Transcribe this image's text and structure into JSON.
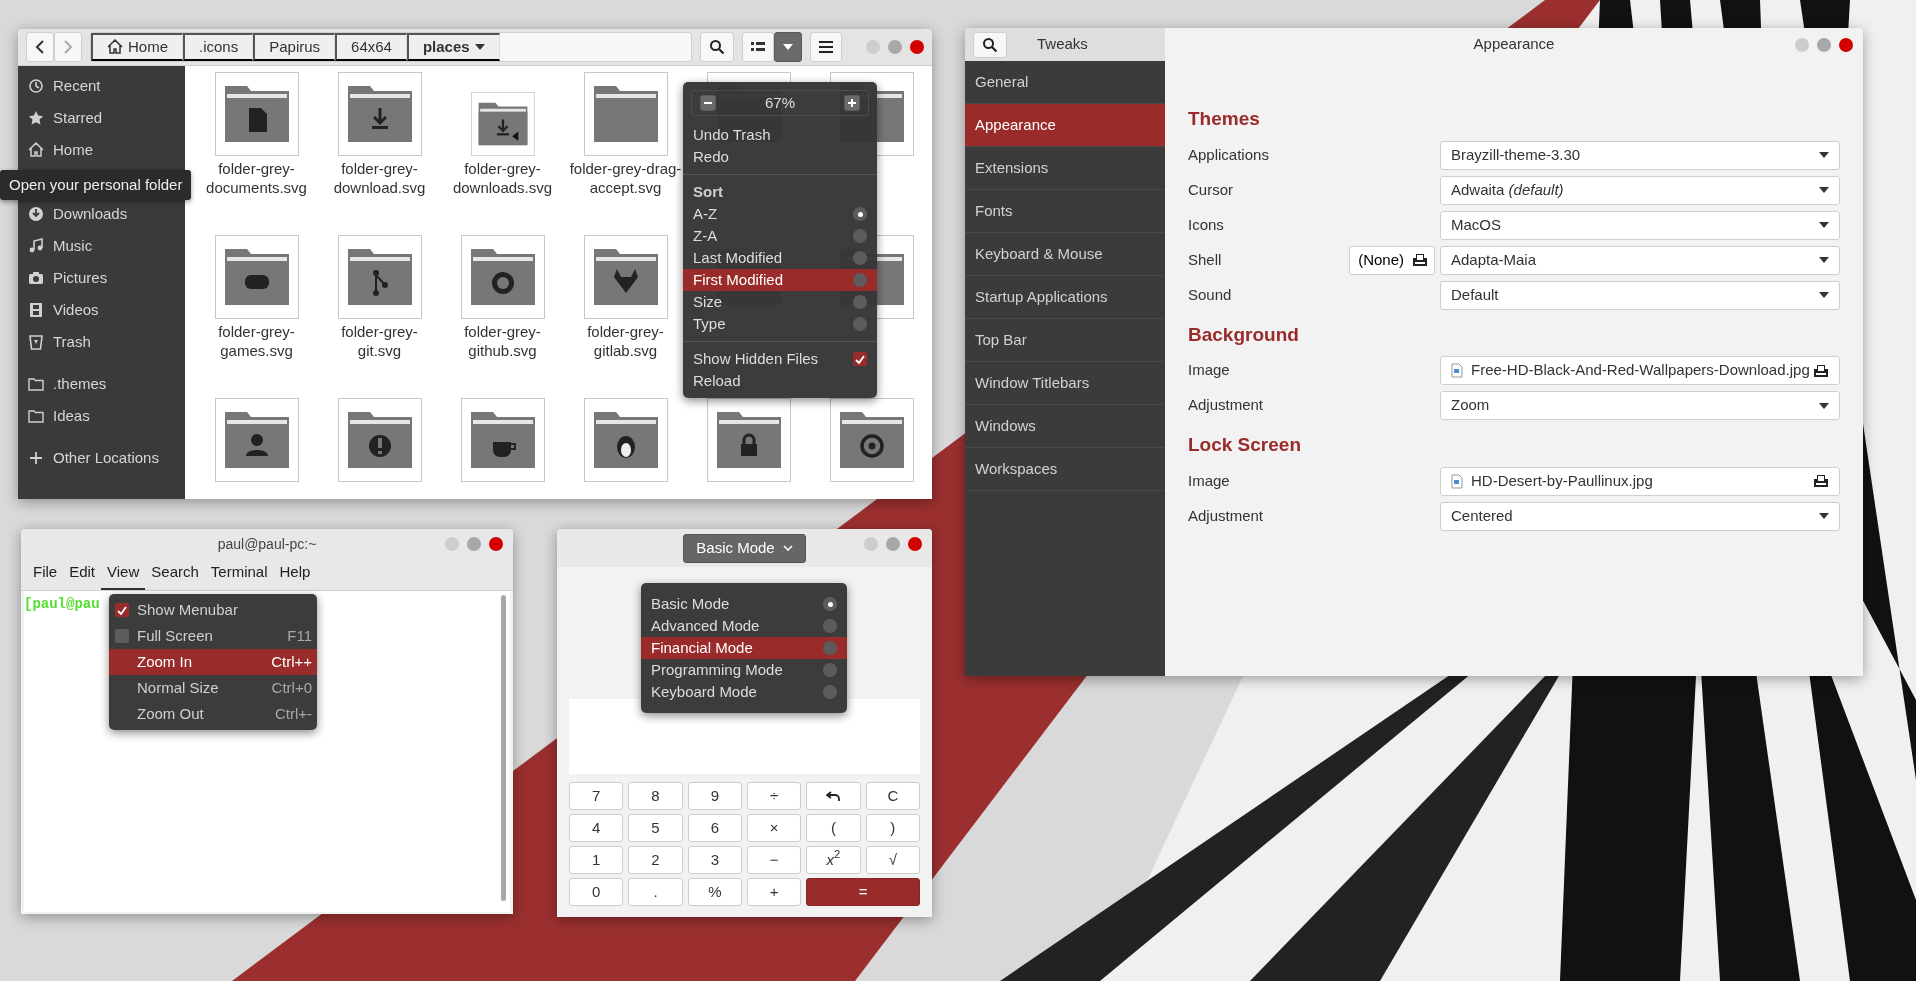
{
  "file_manager": {
    "breadcrumb": [
      {
        "kind": "home",
        "label": "Home"
      },
      {
        "kind": "dir",
        "label": ".icons"
      },
      {
        "kind": "dir",
        "label": "Papirus"
      },
      {
        "kind": "dir",
        "label": "64x64"
      },
      {
        "kind": "current",
        "label": "places"
      }
    ],
    "view_dropdown": {
      "pressed": true
    },
    "sidebar": [
      {
        "kind": "place",
        "label": "Recent"
      },
      {
        "kind": "place",
        "label": "Starred"
      },
      {
        "kind": "place",
        "label": "Home"
      },
      {
        "kind": "tooltip",
        "label": "Open your personal folder"
      },
      {
        "kind": "place",
        "label": "Downloads"
      },
      {
        "kind": "place",
        "label": "Music"
      },
      {
        "kind": "place",
        "label": "Pictures"
      },
      {
        "kind": "place",
        "label": "Videos"
      },
      {
        "kind": "place",
        "label": "Trash"
      },
      {
        "kind": "bookmark",
        "label": ".themes"
      },
      {
        "kind": "bookmark",
        "label": "Ideas"
      },
      {
        "kind": "other",
        "label": "Other Locations"
      }
    ],
    "files": [
      {
        "kind": "document",
        "label": "folder-grey-documents.svg"
      },
      {
        "kind": "download",
        "label": "folder-grey-download.svg"
      },
      {
        "kind": "downloads",
        "label": "folder-grey-downloads.svg"
      },
      {
        "kind": "plain",
        "label": "folder-grey-drag-accept.svg"
      },
      {
        "kind": "covered"
      },
      {
        "kind": "covered"
      },
      {
        "kind": "games",
        "label": "folder-grey-games.svg"
      },
      {
        "kind": "git",
        "label": "folder-grey-git.svg"
      },
      {
        "kind": "github",
        "label": "folder-grey-github.svg"
      },
      {
        "kind": "gitlab",
        "label": "folder-grey-gitlab.svg"
      },
      {
        "kind": "covered"
      },
      {
        "kind": "covered"
      },
      {
        "kind": "user"
      },
      {
        "kind": "important"
      },
      {
        "kind": "cup"
      },
      {
        "kind": "penguin"
      },
      {
        "kind": "lock"
      },
      {
        "kind": "at"
      }
    ],
    "view_menu": {
      "zoom_level": "67%",
      "items": [
        {
          "kind": "action",
          "label": "Undo Trash",
          "highlighted": false
        },
        {
          "kind": "action",
          "label": "Redo",
          "highlighted": false
        },
        {
          "kind": "separator"
        },
        {
          "kind": "heading",
          "label": "Sort"
        },
        {
          "kind": "radio",
          "label": "A-Z",
          "selected": true,
          "highlighted": false
        },
        {
          "kind": "radio",
          "label": "Z-A",
          "selected": false,
          "highlighted": false
        },
        {
          "kind": "radio",
          "label": "Last Modified",
          "selected": false,
          "highlighted": false
        },
        {
          "kind": "radio",
          "label": "First Modified",
          "selected": false,
          "highlighted": true
        },
        {
          "kind": "radio",
          "label": "Size",
          "selected": false,
          "highlighted": false
        },
        {
          "kind": "radio",
          "label": "Type",
          "selected": false,
          "highlighted": false
        },
        {
          "kind": "separator"
        },
        {
          "kind": "check",
          "label": "Show Hidden Files",
          "checked": true,
          "highlighted": false
        },
        {
          "kind": "action",
          "label": "Reload",
          "highlighted": false
        }
      ]
    }
  },
  "tweaks": {
    "title": "Tweaks",
    "page_title": "Appearance",
    "sidebar": [
      {
        "label": "General",
        "selected": false
      },
      {
        "label": "Appearance",
        "selected": true
      },
      {
        "label": "Extensions",
        "selected": false
      },
      {
        "label": "Fonts",
        "selected": false
      },
      {
        "label": "Keyboard & Mouse",
        "selected": false
      },
      {
        "label": "Startup Applications",
        "selected": false
      },
      {
        "label": "Top Bar",
        "selected": false
      },
      {
        "label": "Window Titlebars",
        "selected": false
      },
      {
        "label": "Windows",
        "selected": false
      },
      {
        "label": "Workspaces",
        "selected": false
      }
    ],
    "sections": [
      {
        "title": "Themes",
        "rows": [
          {
            "kind": "combo",
            "label": "Applications",
            "value": "Brayzill-theme-3.30"
          },
          {
            "kind": "combo",
            "label": "Cursor",
            "value": "Adwaita *(default)*"
          },
          {
            "kind": "combo",
            "label": "Icons",
            "value": "MacOS"
          },
          {
            "kind": "combo",
            "label": "Shell",
            "value": "Adapta-Maia",
            "extra_button": "(None)"
          },
          {
            "kind": "combo",
            "label": "Sound",
            "value": "Default"
          }
        ]
      },
      {
        "title": "Background",
        "rows": [
          {
            "kind": "file",
            "label": "Image",
            "value": "Free-HD-Black-And-Red-Wallpapers-Download.jpg"
          },
          {
            "kind": "combo",
            "label": "Adjustment",
            "value": "Zoom"
          }
        ]
      },
      {
        "title": "Lock Screen",
        "rows": [
          {
            "kind": "file",
            "label": "Image",
            "value": "HD-Desert-by-Paullinux.jpg"
          },
          {
            "kind": "combo",
            "label": "Adjustment",
            "value": "Centered"
          }
        ]
      }
    ]
  },
  "terminal": {
    "title": "paul@paul-pc:~",
    "menubar": [
      {
        "label": "File",
        "selected": false
      },
      {
        "label": "Edit",
        "selected": false
      },
      {
        "label": "View",
        "selected": true
      },
      {
        "label": "Search",
        "selected": false
      },
      {
        "label": "Terminal",
        "selected": false
      },
      {
        "label": "Help",
        "selected": false
      }
    ],
    "prompt": "[paul@pau",
    "menu": [
      {
        "kind": "check",
        "label": "Show Menubar",
        "checked": true,
        "highlighted": false
      },
      {
        "kind": "check",
        "label": "Full Screen",
        "checked": false,
        "shortcut": "F11",
        "highlighted": false
      },
      {
        "kind": "action",
        "label": "Zoom In",
        "shortcut": "Ctrl++",
        "highlighted": true
      },
      {
        "kind": "action",
        "label": "Normal Size",
        "shortcut": "Ctrl+0",
        "highlighted": false
      },
      {
        "kind": "action",
        "label": "Zoom Out",
        "shortcut": "Ctrl+-",
        "highlighted": false
      }
    ]
  },
  "calculator": {
    "mode_button": "Basic Mode",
    "modes": [
      {
        "label": "Basic Mode",
        "selected": true,
        "highlighted": false
      },
      {
        "label": "Advanced Mode",
        "selected": false,
        "highlighted": false
      },
      {
        "label": "Financial Mode",
        "selected": false,
        "highlighted": true
      },
      {
        "label": "Programming Mode",
        "selected": false,
        "highlighted": false
      },
      {
        "label": "Keyboard Mode",
        "selected": false,
        "highlighted": false
      }
    ],
    "keys": [
      {
        "kind": "key",
        "label": "7"
      },
      {
        "kind": "key",
        "label": "8"
      },
      {
        "kind": "key",
        "label": "9"
      },
      {
        "kind": "key",
        "label": "÷"
      },
      {
        "kind": "undo"
      },
      {
        "kind": "key",
        "label": "C"
      },
      {
        "kind": "key",
        "label": "4"
      },
      {
        "kind": "key",
        "label": "5"
      },
      {
        "kind": "key",
        "label": "6"
      },
      {
        "kind": "key",
        "label": "×"
      },
      {
        "kind": "key",
        "label": "("
      },
      {
        "kind": "key",
        "label": ")"
      },
      {
        "kind": "key",
        "label": "1"
      },
      {
        "kind": "key",
        "label": "2"
      },
      {
        "kind": "key",
        "label": "3"
      },
      {
        "kind": "key",
        "label": "−"
      },
      {
        "kind": "key",
        "label": "*x*$^{2}$"
      },
      {
        "kind": "key",
        "label": "√"
      },
      {
        "kind": "key",
        "label": "0"
      },
      {
        "kind": "key",
        "label": "."
      },
      {
        "kind": "key",
        "label": "%"
      },
      {
        "kind": "key",
        "label": "+"
      },
      {
        "kind": "equals",
        "label": "="
      }
    ]
  }
}
